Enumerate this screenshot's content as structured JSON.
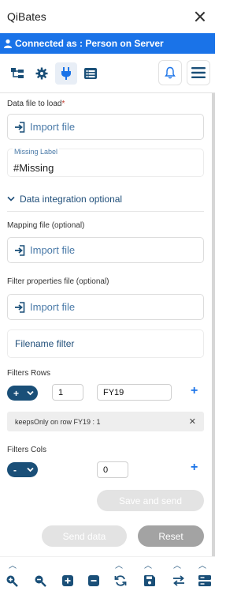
{
  "app": {
    "title": "QiBates"
  },
  "banner": {
    "text": "Connected as : Person on Server"
  },
  "form": {
    "data_file_label": "Data file to load",
    "required_mark": "*",
    "import_label": "Import file",
    "missing_label": "Missing Label",
    "missing_value": "#Missing",
    "section_title": "Data integration optional",
    "mapping_label": "Mapping file (optional)",
    "filter_props_label": "Filter properties file (optional)",
    "filename_filter": "Filename filter",
    "filters_rows_label": "Filters Rows",
    "rows_operator": "+",
    "rows_index": "1",
    "rows_value": "FY19",
    "rows_add": "+",
    "chip_text": "keepsOnly on row FY19 : 1",
    "chip_close": "✕",
    "filters_cols_label": "Filters Cols",
    "cols_operator": "-",
    "cols_value": "0",
    "cols_add": "+",
    "save_send": "Save and send",
    "send_data": "Send data",
    "reset": "Reset"
  },
  "colors": {
    "accent": "#1a73e8",
    "dark": "#1a4f78",
    "link": "#4a7aa8"
  }
}
